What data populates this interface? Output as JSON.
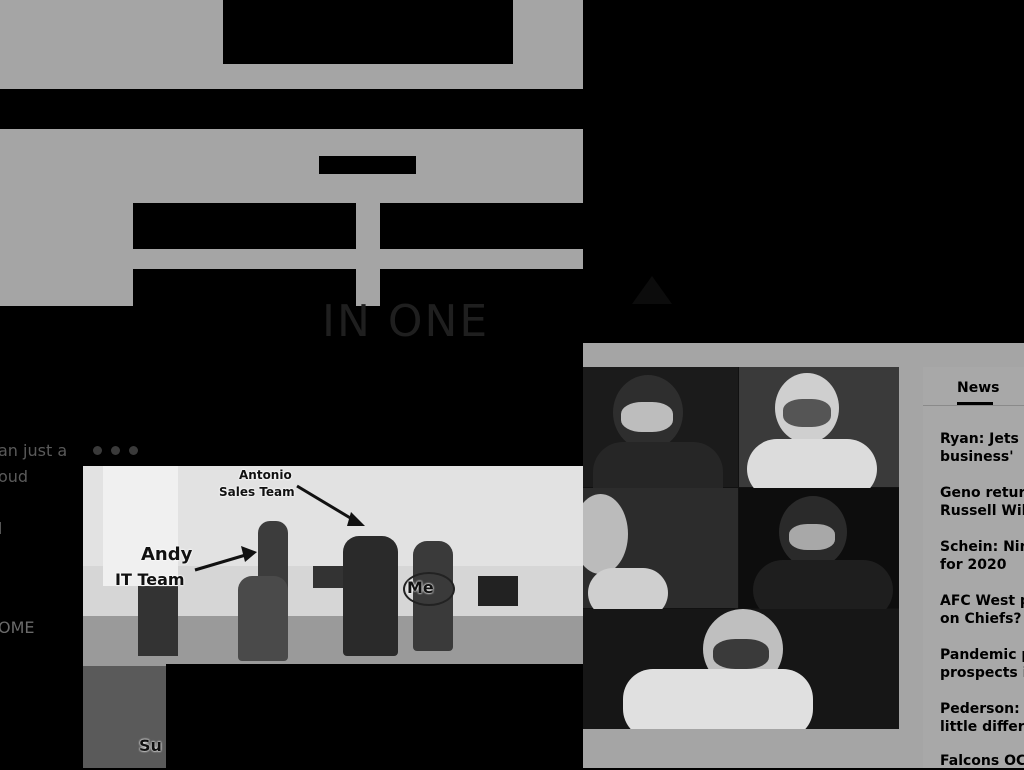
{
  "hero": {
    "big_text": "IN ONE"
  },
  "left_panel": {
    "line1": "an just a",
    "line2": "oud",
    "line3": "l",
    "home": "OME"
  },
  "office_photo": {
    "label_antonio_name": "Antonio",
    "label_antonio_team": "Sales Team",
    "label_andy_name": "Andy",
    "label_andy_team": "IT Team",
    "label_me": "Me",
    "label_su": "Su"
  },
  "news": {
    "tab_label": "News",
    "items": [
      {
        "line1": "Ryan: Jets 'm",
        "line2": "business'"
      },
      {
        "line1": "Geno returnin",
        "line2": "Russell Wilso"
      },
      {
        "line1": "Schein: Nine",
        "line2": "for 2020"
      },
      {
        "line1": "AFC West pro",
        "line2": "on Chiefs?"
      },
      {
        "line1": "Pandemic pu",
        "line2": "prospects in"
      },
      {
        "line1": "Pederson: Ea",
        "line2": "little differen"
      },
      {
        "line1": "Falcons OC: ",
        "line2": ""
      }
    ]
  }
}
